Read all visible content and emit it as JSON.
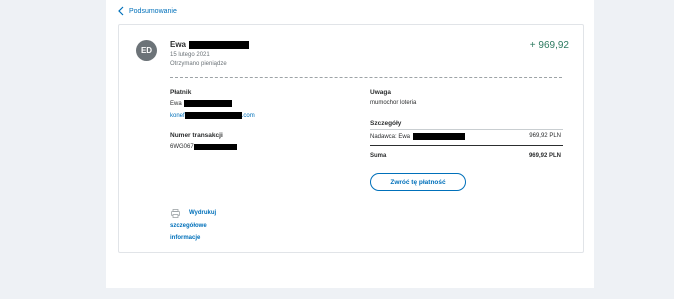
{
  "nav": {
    "back_label": "Podsumowanie"
  },
  "transaction": {
    "avatar_initials": "ED",
    "name": "Ewa",
    "date": "15 lutego 2021",
    "status": "Otrzymano pieniądze",
    "amount": "+ 969,92"
  },
  "payer": {
    "label": "Płatnik",
    "name": "Ewa",
    "email_prefix": "konef",
    "email_suffix": ".com"
  },
  "transaction_id": {
    "label": "Numer transakcji",
    "prefix": "6WG067"
  },
  "note": {
    "label": "Uwaga",
    "text": "mumochor loteria"
  },
  "details": {
    "label": "Szczegóły",
    "sender_label": "Nadawca: Ewa",
    "sender_amount": "969,92 PLN",
    "total_label": "Suma",
    "total_amount": "969,92 PLN"
  },
  "actions": {
    "refund_label": "Zwróć tę płatność",
    "print_label": "Wydrukuj",
    "print_line2": "szczegółowe",
    "print_line3": "informacje"
  },
  "colors": {
    "link": "#0070ba",
    "amount": "#2c7a60",
    "avatar_bg": "#6c7378",
    "page_bg": "#eef1f5"
  },
  "icons": {
    "back": "chevron-left-icon",
    "print": "printer-icon"
  }
}
